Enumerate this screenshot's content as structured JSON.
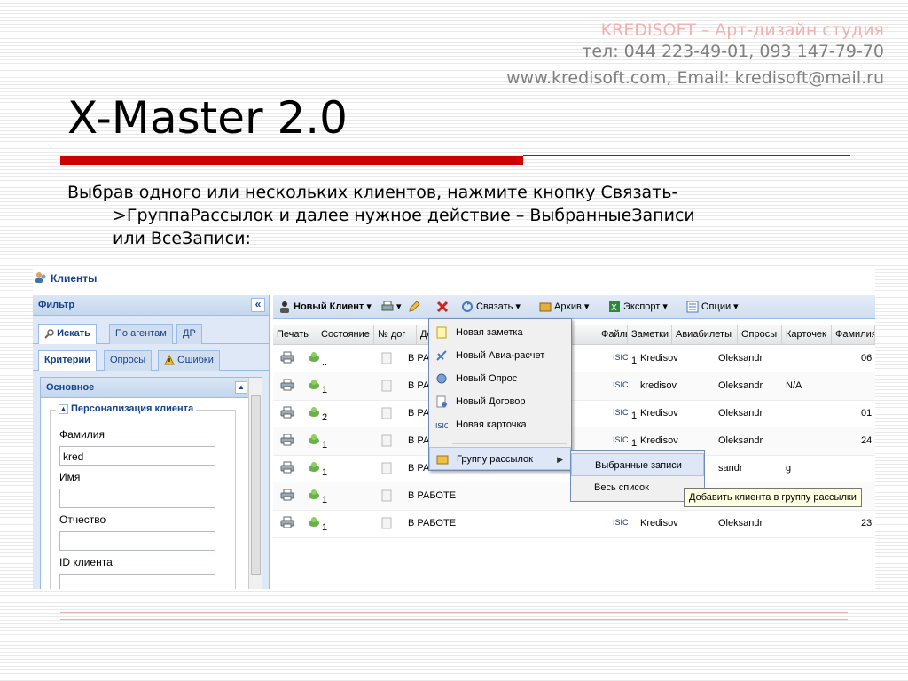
{
  "header": {
    "company_line1": "KREDISOFT – Арт-дизайн студия",
    "company_line2": "тел: 044 223-49-01, 093 147-79-70",
    "company_line3": "www.kredisoft.com, Email: kredisoft@mail.ru"
  },
  "slide": {
    "title": "X-Master 2.0",
    "instruction_line1": "Выбрав одного или нескольких клиентов, нажмите кнопку Связать-",
    "instruction_line2": ">ГруппаРассылок и далее нужное действие – ВыбранныеЗаписи",
    "instruction_line3": "или ВсеЗаписи:"
  },
  "app": {
    "window_title": "Клиенты",
    "filter_panel": {
      "title": "Фильтр",
      "collapse_label": "«",
      "tabs": [
        "Искать",
        "По агентам",
        "ДР"
      ],
      "subtabs": [
        "Критерии",
        "Опросы",
        "Ошибки"
      ],
      "section_title": "Основное",
      "group_title": "Персонализация клиента",
      "fields": [
        {
          "label": "Фамилия",
          "value": "kred"
        },
        {
          "label": "Имя",
          "value": ""
        },
        {
          "label": "Отчество",
          "value": ""
        },
        {
          "label": "ID клиента",
          "value": ""
        }
      ]
    },
    "toolbar": {
      "new_client": "Новый Клиент",
      "link": "Связать",
      "archive": "Архив",
      "export": "Экспорт",
      "options": "Опции"
    },
    "columns": [
      "Печать",
      "Состояние",
      "№ дог",
      "Договора",
      "Файлы",
      "Заметки",
      "Авиабилеты",
      "Опросы",
      "Карточек",
      "Фамилия"
    ],
    "rows": [
      {
        "state_count": "..",
        "status": "В РАБОТЕ",
        "isic": "1",
        "surname": "Kredisov",
        "name": "Oleksandr",
        "extra": "",
        "tail": "06"
      },
      {
        "state_count": "1",
        "status": "В РАБОТЕ",
        "isic": "",
        "surname": "kredisov",
        "name": "Oleksandr",
        "extra": "N/A",
        "tail": ""
      },
      {
        "state_count": "2",
        "status": "В РАБОТЕ",
        "isic": "1",
        "surname": "Kredisov",
        "name": "Oleksandr",
        "extra": "",
        "tail": "01"
      },
      {
        "state_count": "1",
        "status": "В РАБОТЕ",
        "isic": "1",
        "surname": "Kredisov",
        "name": "Oleksandr",
        "extra": "",
        "tail": "24"
      },
      {
        "state_count": "1",
        "status": "В РАБОТЕ",
        "isic": "",
        "surname": "",
        "name": "sandr",
        "extra": "g",
        "tail": ""
      },
      {
        "state_count": "1",
        "status": "В РАБОТЕ",
        "isic": "",
        "surname": "",
        "name": "",
        "extra": "",
        "tail": ""
      },
      {
        "state_count": "1",
        "status": "В РАБОТЕ",
        "isic": "",
        "surname": "Kredisov",
        "name": "Oleksandr",
        "extra": "",
        "tail": "23"
      }
    ],
    "context_menu": {
      "items": [
        "Новая заметка",
        "Новый Авиа-расчет",
        "Новый Опрос",
        "Новый Договор",
        "Новая карточка",
        "Группу рассылок"
      ],
      "submenu": [
        "Выбранные записи",
        "Весь список"
      ],
      "tooltip": "Добавить клиента в группу рассылки"
    }
  }
}
